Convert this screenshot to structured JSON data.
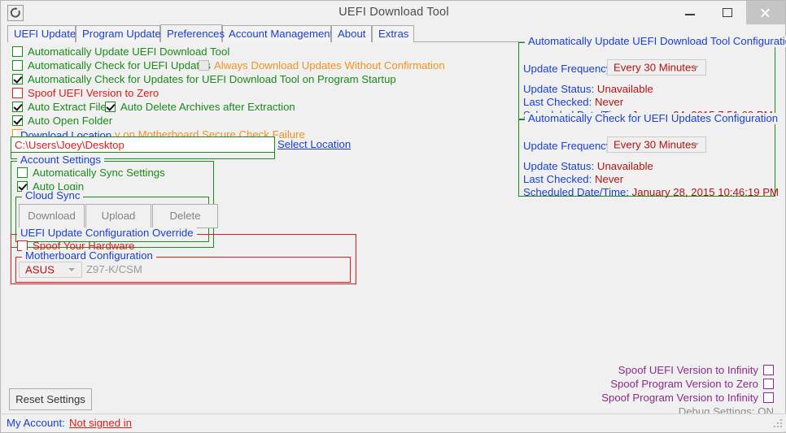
{
  "window": {
    "title": "UEFI Download Tool",
    "icon": "refresh-circle-icon",
    "minimize_label": "—",
    "maximize_label": "□",
    "close_label": "×"
  },
  "tabs": [
    {
      "label": "UEFI Update",
      "active": false
    },
    {
      "label": "Program Update",
      "active": false
    },
    {
      "label": "Preferences",
      "active": true
    },
    {
      "label": "Account Management",
      "active": false
    },
    {
      "label": "About",
      "active": false
    },
    {
      "label": "Extras",
      "active": false
    }
  ],
  "preferences": {
    "checkboxes": [
      {
        "label": "Automatically Update UEFI Download Tool",
        "checked": false,
        "color": "green"
      },
      {
        "label": "Automatically Check for UEFI Updates",
        "checked": false,
        "color": "green"
      },
      {
        "label": "Always Download Updates Without Confirmation",
        "checked": false,
        "color": "orange",
        "disabled": true
      },
      {
        "label": "Automatically Check for Updates for UEFI Download Tool on Program Startup",
        "checked": true,
        "color": "green"
      },
      {
        "label": "Spoof UEFI Version to Zero",
        "checked": false,
        "color": "red"
      },
      {
        "label": "Auto Extract Files",
        "checked": true,
        "color": "green"
      },
      {
        "label": "Auto Delete Archives after Extraction",
        "checked": true,
        "color": "green"
      },
      {
        "label": "Auto Open Folder",
        "checked": true,
        "color": "green"
      },
      {
        "label": "Automatically Retry on Motherboard Secure Check Failure",
        "checked": false,
        "color": "orange",
        "disabled": true
      }
    ]
  },
  "download_location": {
    "title": "Download Location",
    "path": "C:\\Users\\Joey\\Desktop",
    "select_link": "Select Location"
  },
  "account_settings": {
    "title": "Account Settings",
    "auto_sync": {
      "label": "Automatically Sync Settings",
      "checked": false
    },
    "auto_login": {
      "label": "Auto Login",
      "checked": true
    },
    "cloud_sync": {
      "title": "Cloud Sync",
      "buttons": [
        "Download",
        "Upload",
        "Delete"
      ]
    }
  },
  "override": {
    "title": "UEFI Update Configuration Override",
    "spoof_hardware": {
      "label": "Spoof Your Hardware",
      "checked": false
    },
    "motherboard": {
      "title": "Motherboard Configuration",
      "brand": "ASUS",
      "model": "Z97-K/CSM"
    }
  },
  "config_panels": [
    {
      "title": "Automatically Update UEFI Download Tool Configuration",
      "frequency_label": "Update Frequency",
      "frequency_value": "Every 30 Minutes",
      "status_label": "Update Status:",
      "status_value": "Unavailable",
      "last_checked_label": "Last Checked:",
      "last_checked_value": "Never",
      "scheduled_label": "Scheduled Date/Time:",
      "scheduled_value": "January 24, 2015 7:51:00 PM"
    },
    {
      "title": "Automatically Check for UEFI Updates Configuration",
      "frequency_label": "Update Frequency",
      "frequency_value": "Every 30 Minutes",
      "status_label": "Update Status:",
      "status_value": "Unavailable",
      "last_checked_label": "Last Checked:",
      "last_checked_value": "Never",
      "scheduled_label": "Scheduled Date/Time:",
      "scheduled_value": "January 28, 2015 10:46:19 PM"
    }
  ],
  "spoof_options": [
    {
      "label": "Spoof UEFI Version to Infinity",
      "checked": false
    },
    {
      "label": "Spoof Program Version to Zero",
      "checked": false
    },
    {
      "label": "Spoof Program Version to Infinity",
      "checked": false
    }
  ],
  "debug": {
    "label": "Debug Settings:",
    "value": "ON"
  },
  "reset_button": "Reset Settings",
  "statusbar": {
    "account_label": "My Account:",
    "account_value": "Not signed in"
  }
}
